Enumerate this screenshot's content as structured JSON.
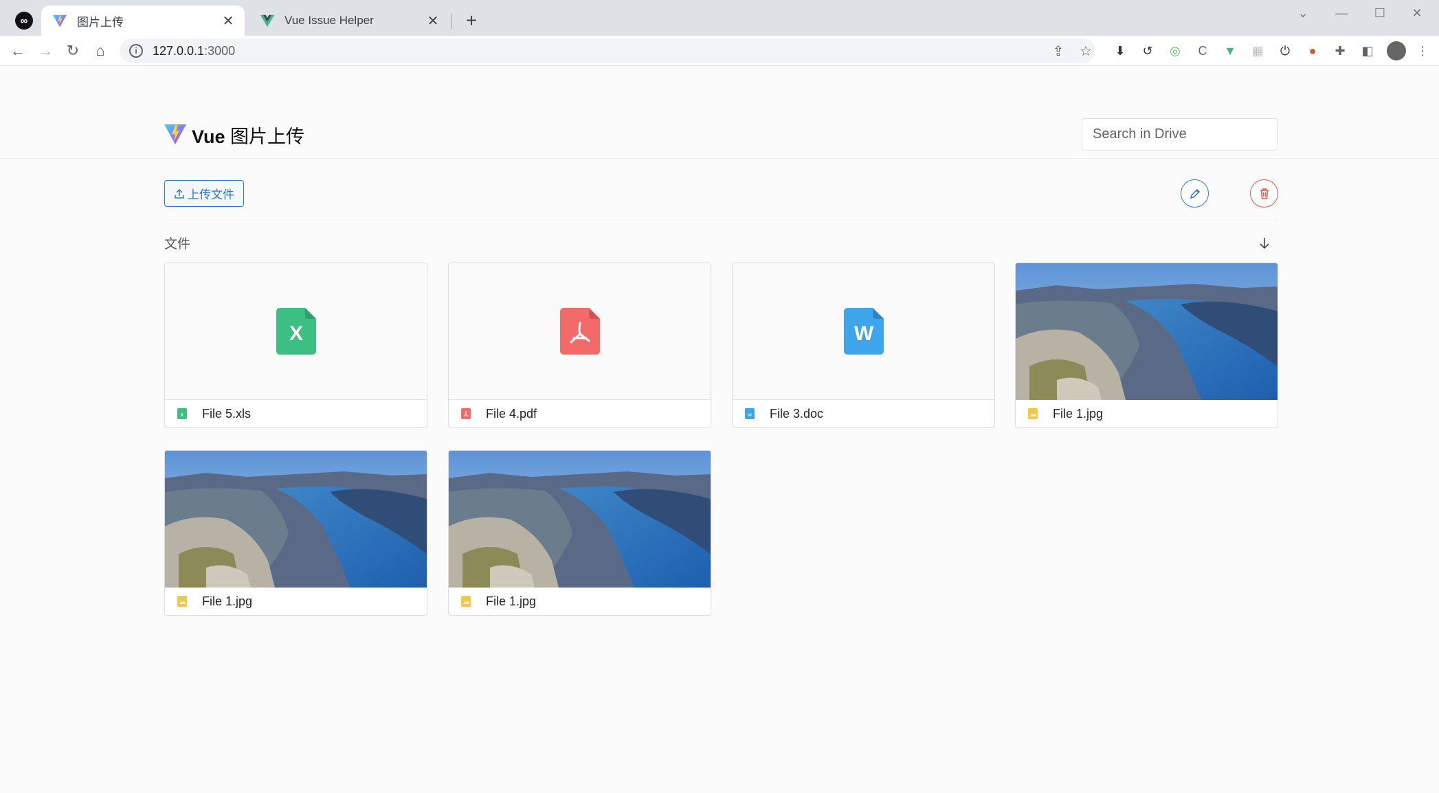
{
  "browser": {
    "tabs": [
      {
        "title": "图片上传",
        "active": true
      },
      {
        "title": "Vue Issue Helper",
        "active": false
      }
    ],
    "url_host": "127.0.0.1",
    "url_port": ":3000"
  },
  "app": {
    "brand": "Vue",
    "title": "图片上传",
    "search_placeholder": "Search in Drive",
    "upload_label": "上传文件",
    "section_title": "文件"
  },
  "files": [
    {
      "name": "File 5.xls",
      "type": "xls",
      "color": "#3dbf84"
    },
    {
      "name": "File 4.pdf",
      "type": "pdf",
      "color": "#f26a6a"
    },
    {
      "name": "File 3.doc",
      "type": "doc",
      "color": "#3fa5ea"
    },
    {
      "name": "File 1.jpg",
      "type": "jpg",
      "color": "#f5c842"
    },
    {
      "name": "File 1.jpg",
      "type": "jpg",
      "color": "#f5c842"
    },
    {
      "name": "File 1.jpg",
      "type": "jpg",
      "color": "#f5c842"
    }
  ],
  "colors": {
    "primary": "#2c74d0",
    "danger": "#e05252"
  },
  "icons": {
    "xls_letter": "X",
    "doc_letter": "W"
  }
}
